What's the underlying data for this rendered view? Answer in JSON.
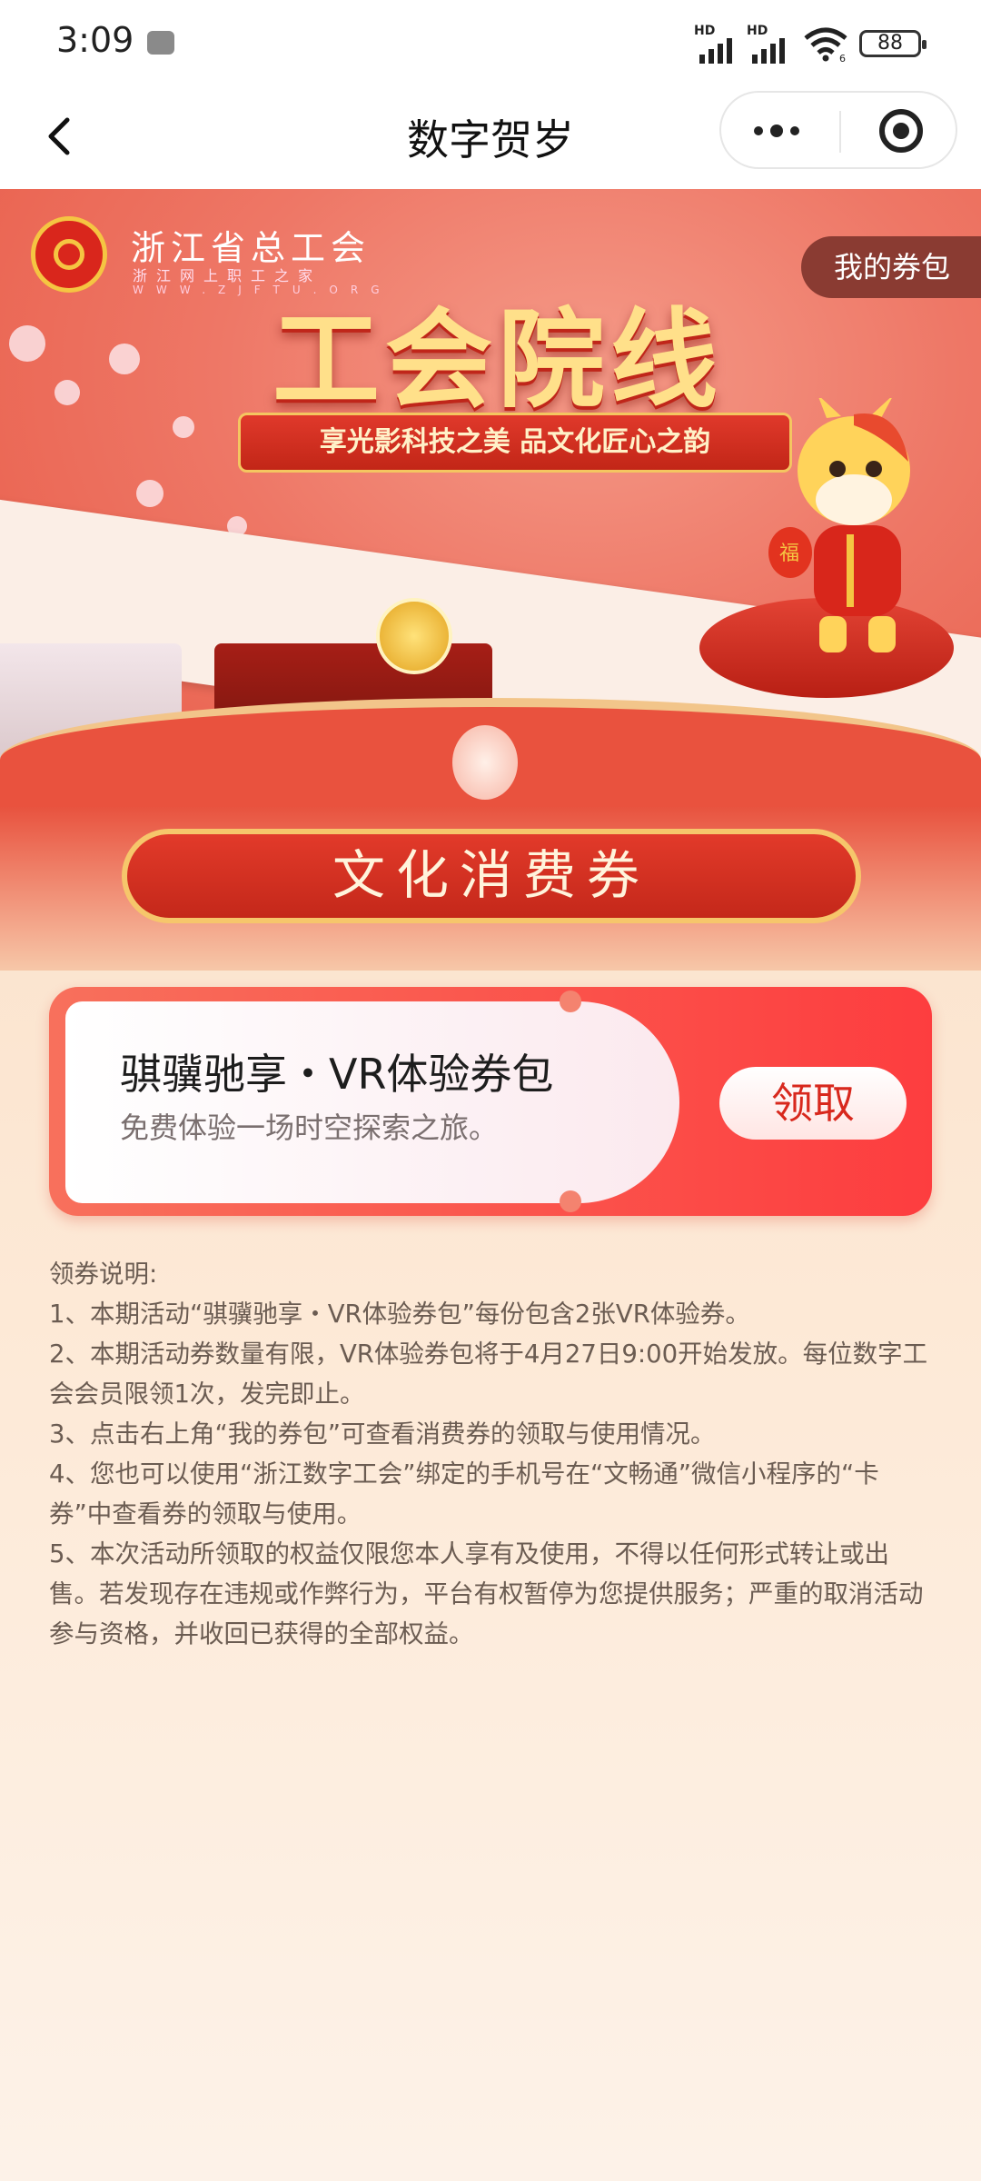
{
  "status_bar": {
    "time": "3:09",
    "signal1_label": "HD",
    "signal2_label": "HD",
    "wifi_label": "6",
    "battery": "88"
  },
  "nav": {
    "title": "数字贺岁"
  },
  "banner": {
    "org_name": "浙江省总工会",
    "org_subtitle": "浙江网上职工之家",
    "org_url": "WWW.ZJFTU.ORG",
    "my_wallet": "我的券包",
    "main_title": "工会院线",
    "slogan": "享光影科技之美 品文化匠心之韵",
    "mascot_badge": "福"
  },
  "section": {
    "ribbon": "文化消费券"
  },
  "coupon": {
    "title": "骐骥驰享・VR体验券包",
    "description": "免费体验一场时空探索之旅。",
    "claim": "领取"
  },
  "rules": {
    "heading": "领券说明:",
    "items": [
      "1、本期活动“骐骥驰享・VR体验券包”每份包含2张VR体验券。",
      "2、本期活动券数量有限，VR体验券包将于4月27日9:00开始发放。每位数字工会会员限领1次，发完即止。",
      "3、点击右上角“我的券包”可查看消费券的领取与使用情况。",
      "4、您也可以使用“浙江数字工会”绑定的手机号在“文畅通”微信小程序的“卡券”中查看券的领取与使用。",
      "5、本次活动所领取的权益仅限您本人享有及使用，不得以任何形式转让或出售。若发现存在违规或作弊行为，平台有权暂停为您提供服务；严重的取消活动参与资格，并收回已获得的全部权益。"
    ]
  },
  "colors": {
    "accent_red": "#e23a2a",
    "gold": "#f6c66b",
    "page_background": "#fde9d6"
  }
}
